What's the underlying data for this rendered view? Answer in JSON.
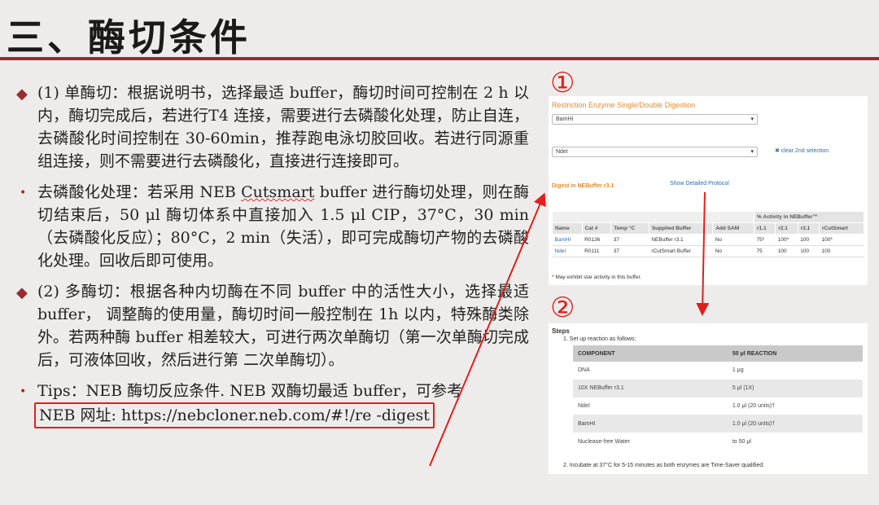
{
  "slide": {
    "title": "三、酶切条件",
    "markers": [
      "①",
      "②"
    ]
  },
  "paragraphs": [
    {
      "bullet": "diamond",
      "text": "(1) 单酶切：根据说明书，选择最适 buffer，酶切时间可控制在 2 h 以内，酶切完成后，若进行T4 连接，需要进行去磷酸化处理，防止自连，去磷酸化时间控制在 30-60min，推荐跑电泳切胶回收。若进行同源重组连接，则不需要进行去磷酸化，直接进行连接即可。"
    },
    {
      "bullet": "dot",
      "text_before": " 去磷酸化处理：若采用 NEB ",
      "highlight": "Cutsmart",
      "text_after": " buffer 进行酶切处理，则在酶切结束后，50 μl 酶切体系中直接加入 1.5 μl CIP，37°C，30 min（去磷酸化反应）；80°C，2 min（失活），即可完成酶切产物的去磷酸化处理。回收后即可使用。"
    },
    {
      "bullet": "diamond",
      "text": " (2) 多酶切：根据各种内切酶在不同 buffer 中的活性大小，选择最适 buffer， 调整酶的使用量，酶切时间一般控制在 1h 以内，特殊酶类除外。若两种酶 buffer 相差较大，可进行两次单酶切（第一次单酶切完成后，可液体回收，然后进行第 二次单酶切）。"
    },
    {
      "bullet": "dot",
      "text": "Tips：NEB 酶切反应条件. NEB 双酶切最适 buffer，可参考",
      "link": "NEB 网址: https://nebcloner.neb.com/#!/re -digest"
    }
  ],
  "panel1": {
    "heading": "Restriction Enzyme Single/Double Digestion",
    "select1": "BamHI",
    "select2": "NdeI",
    "clear": "✖ clear 2nd selection",
    "digest_title": "Digest in NEBuffer r3.1",
    "protocol_link": "Show Detailed Protocol",
    "group_header": "% Activity in NEBuffer™",
    "headers": [
      "Name",
      "Cat #",
      "Temp °C",
      "Supplied Buffer",
      "Add SAM",
      "r1.1",
      "r2.1",
      "r3.1",
      "rCutSmart"
    ],
    "rows": [
      [
        "BamHI",
        "R0136",
        "37",
        "NEBuffer r3.1",
        "No",
        "75*",
        "100*",
        "100",
        "100*"
      ],
      [
        "NdeI",
        "R0111",
        "37",
        "rCutSmart Buffer",
        "No",
        "75",
        "100",
        "100",
        "100"
      ]
    ],
    "footnote": "* May exhibit star activity in this buffer."
  },
  "panel2": {
    "steps_title": "Steps",
    "step1": "1. Set up reaction as follows:",
    "headers": [
      "COMPONENT",
      "50 μl REACTION"
    ],
    "rows": [
      [
        "DNA",
        "1 μg"
      ],
      [
        "10X NEBuffer r3.1",
        "5 μl (1X)"
      ],
      [
        "NdeI",
        "1.0 μl (20 units)†"
      ],
      [
        "BamHI",
        "1.0 μl (20 units)†"
      ],
      [
        "Nuclease-free Water",
        "to 50 μl"
      ]
    ],
    "step2": "2. Incubate at 37°C for 5-15 minutes as both enzymes are Time-Saver qualified."
  },
  "colors": {
    "accent": "#9b2a2f",
    "annotation": "#e0201c",
    "heading_orange": "#e38a2b",
    "link_blue": "#2a6bb0"
  }
}
